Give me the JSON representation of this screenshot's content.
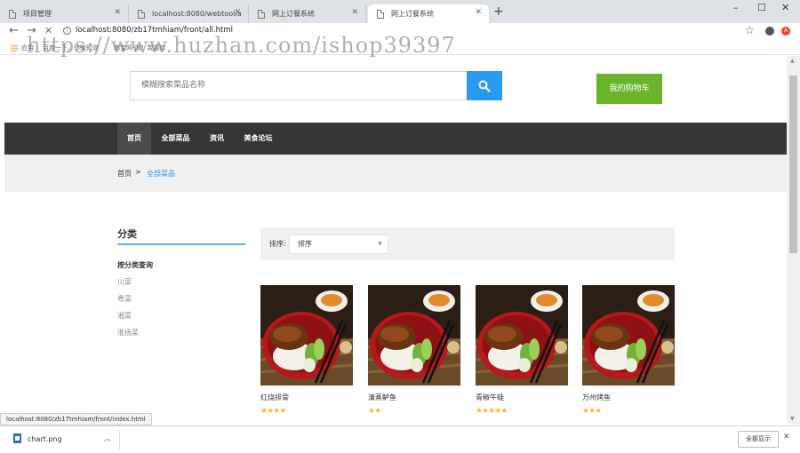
{
  "browser": {
    "tabs": [
      {
        "label": "项目管理",
        "close": "✕"
      },
      {
        "label": "localhost:8080/webtool/all/inc",
        "close": "✕"
      },
      {
        "label": "网上订餐系统",
        "close": "✕"
      },
      {
        "label": "网上订餐系统",
        "close": "✕"
      }
    ],
    "new_tab": "+",
    "window_controls": {
      "minimize": "–",
      "maximize": "☐",
      "close": "✕"
    },
    "nav": {
      "back": "←",
      "forward": "→",
      "stop": "✕"
    },
    "info_icon": "i",
    "url": "localhost:8080/zb17tmhiam/front/all.html",
    "bookmark_star": "☆",
    "extension_badge": "A",
    "bookmarks": [
      "应用",
      "百度一下，你就知道",
      "淘宝网-淘！我喜欢"
    ]
  },
  "watermark": "https://www.huzhan.com/ishop39397",
  "header": {
    "search_placeholder": "模糊搜索菜品名称",
    "cart_label": "我的购物车"
  },
  "mainnav": {
    "items": [
      "首页",
      "全部菜品",
      "资讯",
      "美食论坛"
    ],
    "active_index": 0
  },
  "breadcrumb": {
    "home": "首页",
    "separator": ">",
    "current": "全部菜品"
  },
  "sidebar": {
    "title": "分类",
    "subtitle": "按分类查询",
    "items": [
      "川菜",
      "粤菜",
      "湘菜",
      "淮扬菜"
    ]
  },
  "sort": {
    "label": "排序:",
    "selected": "排序",
    "caret": "▼"
  },
  "products": [
    {
      "name": "红烧排骨",
      "rating": 4,
      "stars": "★★★★"
    },
    {
      "name": "清蒸鲈鱼",
      "rating": 2,
      "stars": "★★"
    },
    {
      "name": "青椒牛蛙",
      "rating": 5,
      "stars": "★★★★★"
    },
    {
      "name": "万州烤鱼",
      "rating": 3,
      "stars": "★★★"
    }
  ],
  "scrollbar": {
    "up": "▲",
    "down": "▼"
  },
  "status_url": "localhost:8080/zb17tmhiam/front/index.html",
  "download": {
    "file": "chart.png",
    "chevron": "︿",
    "show_all": "全部显示",
    "close": "✕"
  },
  "colors": {
    "accent_blue": "#2a9af0",
    "cart_green": "#6ab42b",
    "nav_dark": "#363636",
    "star_gold": "#f0b93a"
  }
}
